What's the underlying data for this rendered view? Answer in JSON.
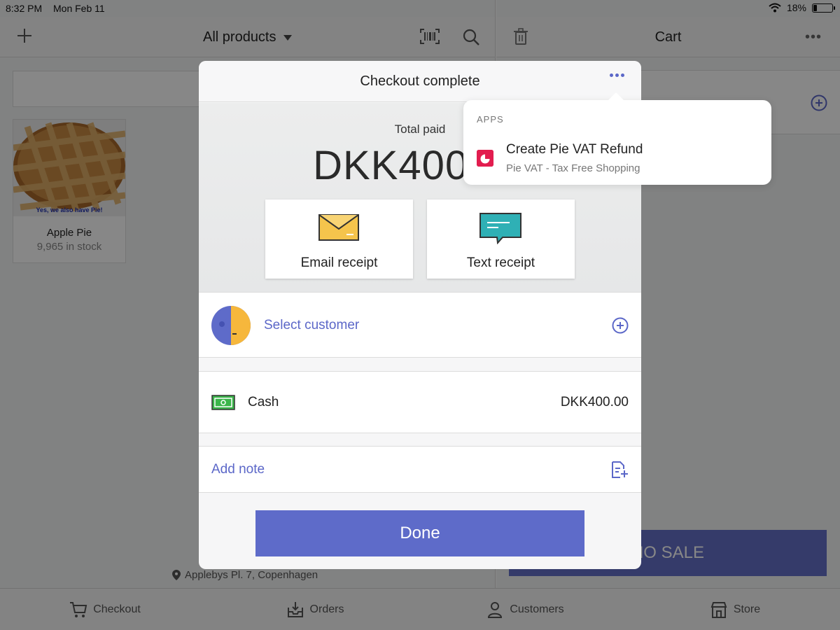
{
  "status_bar": {
    "time": "8:32 PM",
    "date": "Mon Feb 11",
    "battery_percent": "18%",
    "battery_level": 0.18
  },
  "products_nav": {
    "title": "All products"
  },
  "cart_nav": {
    "title": "Cart",
    "more": "•••"
  },
  "product": {
    "image_caption": "Yes, we also have Pie!",
    "name": "Apple Pie",
    "stock": "9,965 in stock"
  },
  "location": "Applebys Pl. 7, Copenhagen",
  "no_sale_label": "NO SALE",
  "tabs": [
    {
      "label": "Checkout",
      "icon": "cart-icon"
    },
    {
      "label": "Orders",
      "icon": "orders-icon"
    },
    {
      "label": "Customers",
      "icon": "person-icon"
    },
    {
      "label": "Store",
      "icon": "store-icon"
    }
  ],
  "modal": {
    "title": "Checkout complete",
    "total_label": "Total paid",
    "total_amount": "DKK400.00",
    "email_receipt": "Email receipt",
    "text_receipt": "Text receipt",
    "select_customer": "Select customer",
    "payment_method": "Cash",
    "payment_amount": "DKK400.00",
    "add_note": "Add note",
    "done": "Done"
  },
  "popover": {
    "section": "APPS",
    "item_title": "Create Pie VAT Refund",
    "item_subtitle": "Pie VAT - Tax Free Shopping"
  },
  "colors": {
    "accent": "#5e6bc9",
    "link": "#5b67c8",
    "pie_vat": "#e21d4f",
    "cash_green": "#3bb54a",
    "envelope": "#f5c44c",
    "chat_teal": "#2fb0b5"
  }
}
